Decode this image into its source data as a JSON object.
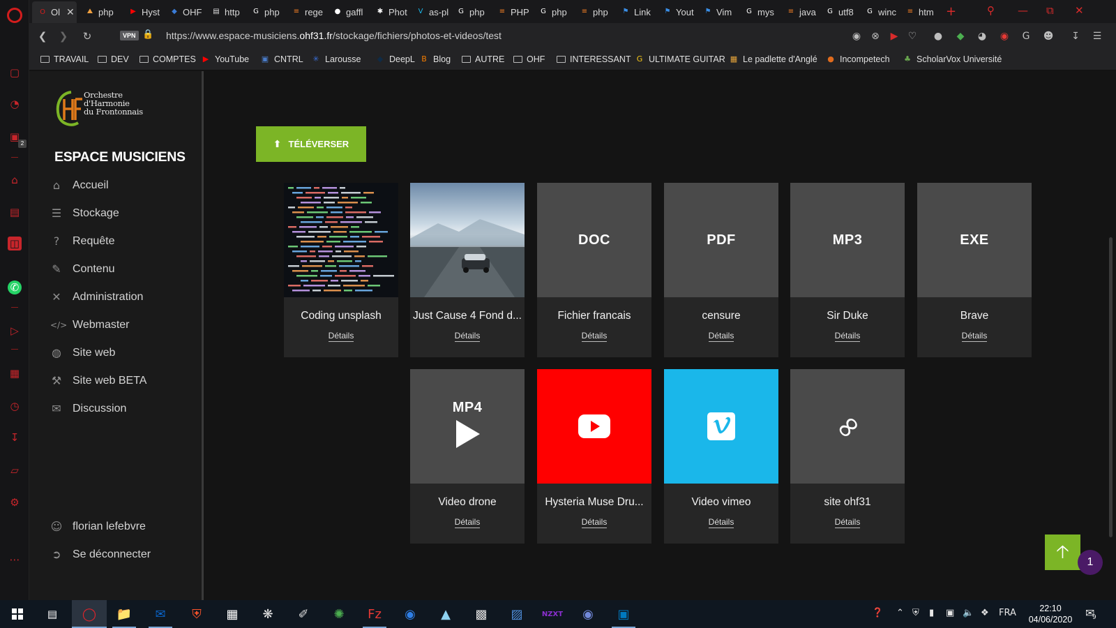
{
  "browser": {
    "tabs": [
      {
        "label": "Ol",
        "icon": "opera-icon",
        "color": "#d21d1d"
      },
      {
        "label": "php",
        "icon": "php-icon",
        "color": "#f0a040"
      },
      {
        "label": "Hyst",
        "icon": "youtube-icon",
        "color": "#ff0000"
      },
      {
        "label": "OHF",
        "icon": "diamond-icon",
        "color": "#3a7bd5"
      },
      {
        "label": "http",
        "icon": "page-icon",
        "color": "#dddddd"
      },
      {
        "label": "php",
        "icon": "google-icon",
        "color": "#ffffff"
      },
      {
        "label": "rege",
        "icon": "stack-icon",
        "color": "#f48024"
      },
      {
        "label": "gaffl",
        "icon": "github-icon",
        "color": "#ffffff"
      },
      {
        "label": "Phot",
        "icon": "gear-icon",
        "color": "#ffffff"
      },
      {
        "label": "as-pl",
        "icon": "vimeo-icon",
        "color": "#1ab7ea"
      },
      {
        "label": "php",
        "icon": "google-icon",
        "color": "#ffffff"
      },
      {
        "label": "PHP",
        "icon": "stack-icon",
        "color": "#f48024"
      },
      {
        "label": "php",
        "icon": "google-icon",
        "color": "#ffffff"
      },
      {
        "label": "php",
        "icon": "stack-icon",
        "color": "#f48024"
      },
      {
        "label": "Link",
        "icon": "flag-icon",
        "color": "#3a8ee6"
      },
      {
        "label": "Yout",
        "icon": "flag-icon",
        "color": "#3a8ee6"
      },
      {
        "label": "Vim",
        "icon": "flag-icon",
        "color": "#3a8ee6"
      },
      {
        "label": "mys",
        "icon": "google-icon",
        "color": "#ffffff"
      },
      {
        "label": "java",
        "icon": "stack-icon",
        "color": "#f48024"
      },
      {
        "label": "utf8",
        "icon": "google-icon",
        "color": "#ffffff"
      },
      {
        "label": "winc",
        "icon": "google-icon",
        "color": "#ffffff"
      },
      {
        "label": "htm",
        "icon": "stack-icon",
        "color": "#f48024"
      }
    ],
    "address": {
      "vpn": "VPN",
      "url_prefix": "https://www.espace-musiciens.",
      "url_domain": "ohf31.fr",
      "url_path": "/stockage/fichiers/photos-et-videos/test"
    },
    "bookmarks": [
      {
        "label": "TRAVAIL",
        "icon": "folder-icon"
      },
      {
        "label": "DEV",
        "icon": "folder-icon"
      },
      {
        "label": "COMPTES",
        "icon": "folder-icon"
      },
      {
        "label": "YouTube",
        "icon": "youtube-icon"
      },
      {
        "label": "CNTRL",
        "icon": "cntrl-icon"
      },
      {
        "label": "Larousse",
        "icon": "larousse-icon"
      },
      {
        "label": "DeepL",
        "icon": "deepl-icon"
      },
      {
        "label": "Blog",
        "icon": "blogger-icon"
      },
      {
        "label": "AUTRE",
        "icon": "folder-icon"
      },
      {
        "label": "OHF",
        "icon": "folder-icon"
      },
      {
        "label": "INTERESSANT",
        "icon": "folder-icon"
      },
      {
        "label": "ULTIMATE GUITAR",
        "icon": "ug-icon"
      },
      {
        "label": "Le padlette d'Anglé",
        "icon": "padlet-icon"
      },
      {
        "label": "Incompetech",
        "icon": "incompetech-icon"
      },
      {
        "label": "ScholarVox Université",
        "icon": "scholarvox-icon"
      }
    ]
  },
  "sidebar": {
    "logo_lines": [
      "Orchestre",
      "d'Harmonie",
      "du Frontonnais"
    ],
    "title": "ESPACE MUSICIENS",
    "items": [
      {
        "label": "Accueil",
        "icon": "home-icon"
      },
      {
        "label": "Stockage",
        "icon": "database-icon"
      },
      {
        "label": "Requête",
        "icon": "question-icon"
      },
      {
        "label": "Contenu",
        "icon": "edit-icon"
      },
      {
        "label": "Administration",
        "icon": "tools-icon"
      },
      {
        "label": "Webmaster",
        "icon": "code-icon"
      },
      {
        "label": "Site web",
        "icon": "globe-icon"
      },
      {
        "label": "Site web BETA",
        "icon": "hammer-icon"
      },
      {
        "label": "Discussion",
        "icon": "chat-icon"
      }
    ],
    "user": {
      "label": "florian lefebvre",
      "icon": "user-circle-icon"
    },
    "logout": {
      "label": "Se déconnecter",
      "icon": "sign-out-icon"
    }
  },
  "main": {
    "upload_label": "TÉLÉVERSER",
    "files": [
      {
        "title": "Coding unsplash",
        "type": "image-code",
        "link": "Détails"
      },
      {
        "title": "Just Cause 4 Fond d...",
        "type": "image-car",
        "link": "Détails"
      },
      {
        "title": "Fichier francais",
        "type": "doc",
        "label": "DOC",
        "link": "Détails"
      },
      {
        "title": "censure",
        "type": "pdf",
        "label": "PDF",
        "link": "Détails"
      },
      {
        "title": "Sir Duke",
        "type": "mp3",
        "label": "MP3",
        "link": "Détails"
      },
      {
        "title": "Brave",
        "type": "exe",
        "label": "EXE",
        "link": "Détails"
      },
      {
        "title": "Video drone",
        "type": "mp4",
        "label": "MP4",
        "link": "Détails"
      },
      {
        "title": "Hysteria Muse Dru...",
        "type": "youtube",
        "link": "Détails"
      },
      {
        "title": "Video vimeo",
        "type": "vimeo",
        "link": "Détails"
      },
      {
        "title": "site ohf31",
        "type": "link",
        "link": "Détails"
      }
    ],
    "notification_count": "1"
  },
  "taskbar": {
    "language": "FRA",
    "time": "22:10",
    "date": "04/06/2020",
    "notification_count": "9"
  },
  "colors": {
    "accent_green": "#7cb526",
    "youtube_red": "#ff0000",
    "vimeo_blue": "#1ab7ea",
    "opera_red": "#d21d1d"
  }
}
